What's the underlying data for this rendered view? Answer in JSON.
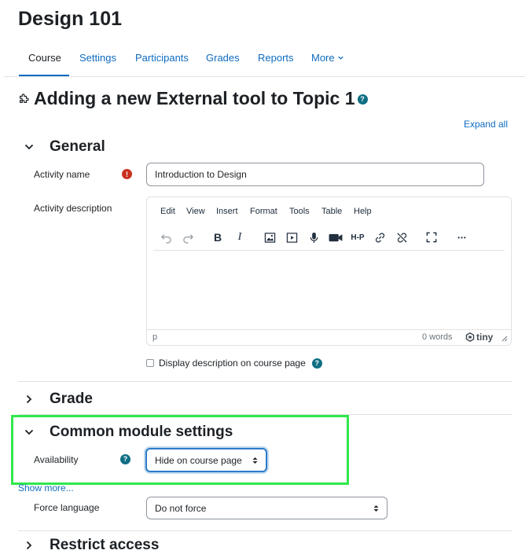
{
  "course": {
    "title": "Design 101"
  },
  "tabs": [
    {
      "label": "Course"
    },
    {
      "label": "Settings"
    },
    {
      "label": "Participants"
    },
    {
      "label": "Grades"
    },
    {
      "label": "Reports"
    },
    {
      "label": "More"
    }
  ],
  "page": {
    "heading": "Adding a new External tool to Topic 1",
    "help_icon_text": "?",
    "expand_all": "Expand all"
  },
  "general": {
    "title": "General",
    "activity_name_label": "Activity name",
    "activity_name_value": "Introduction to Design",
    "required_icon_text": "!",
    "activity_description_label": "Activity description",
    "display_description_label": "Display description on course page"
  },
  "editor": {
    "menu": [
      "Edit",
      "View",
      "Insert",
      "Format",
      "Tools",
      "Table",
      "Help"
    ],
    "toolbar_icons": [
      "undo-icon",
      "redo-icon",
      "bold-icon",
      "italic-icon",
      "image-icon",
      "media-icon",
      "microphone-icon",
      "video-camera-icon",
      "h5p-icon",
      "link-icon",
      "unlink-icon",
      "fullscreen-icon",
      "more-icon"
    ],
    "bold_glyph": "B",
    "italic_glyph": "I",
    "h5p_glyph": "H-P",
    "more_glyph": "•••",
    "status_path": "p",
    "word_count": "0 words",
    "brand": "tiny"
  },
  "grade": {
    "title": "Grade"
  },
  "common_module": {
    "title": "Common module settings",
    "availability_label": "Availability",
    "availability_value": "Hide on course page",
    "show_more": "Show more...",
    "force_language_label": "Force language",
    "force_language_value": "Do not force"
  },
  "restrict": {
    "title": "Restrict access"
  },
  "colors": {
    "link": "#0f6cbf",
    "help": "#0f6e84",
    "required": "#ca3120",
    "highlight": "#2ee84a",
    "focus": "#2c7cc9"
  }
}
